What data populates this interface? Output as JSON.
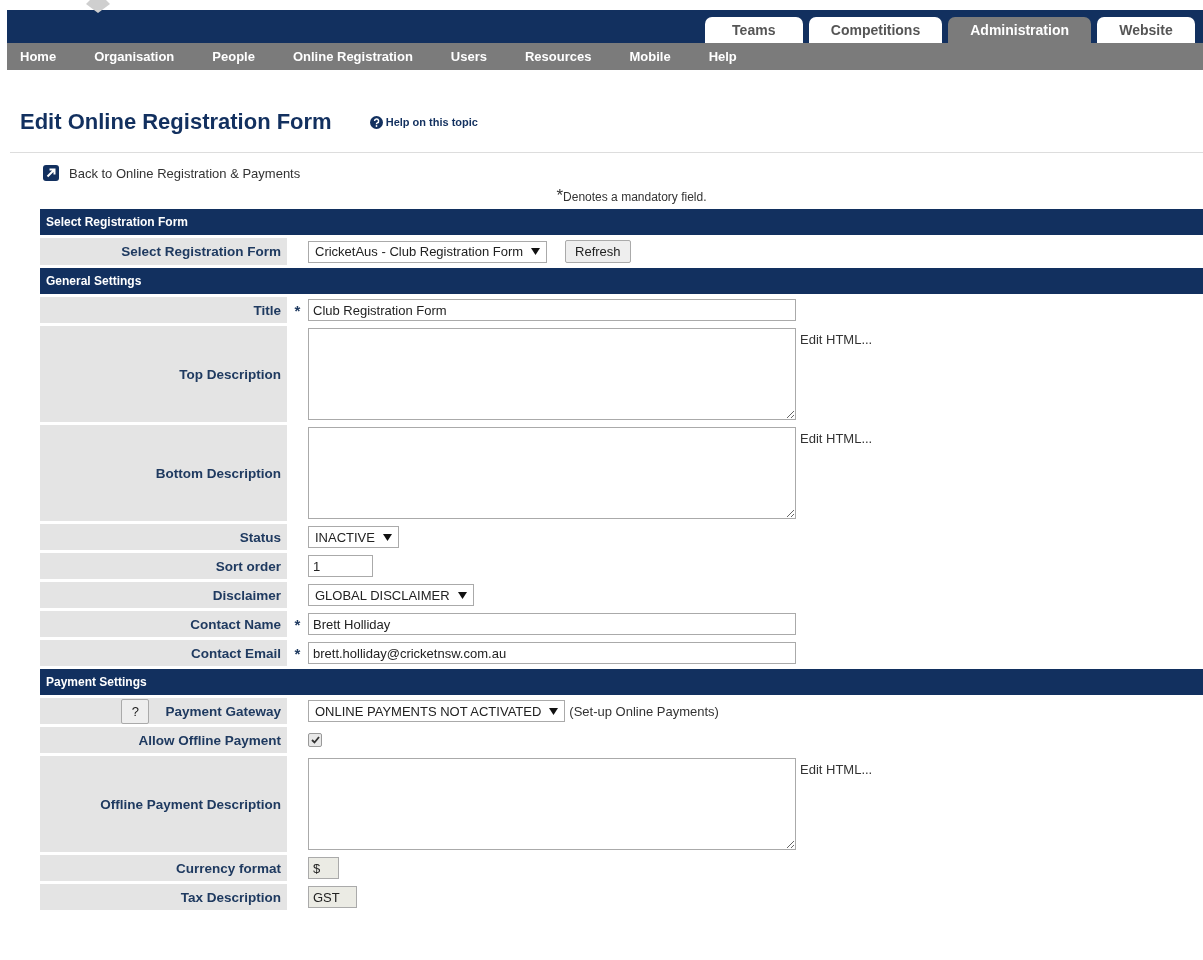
{
  "header_tabs": [
    {
      "label": "Teams",
      "selected": false
    },
    {
      "label": "Competitions",
      "selected": false
    },
    {
      "label": "Administration",
      "selected": true
    },
    {
      "label": "Website",
      "selected": false
    }
  ],
  "nav": [
    "Home",
    "Organisation",
    "People",
    "Online Registration",
    "Users",
    "Resources",
    "Mobile",
    "Help"
  ],
  "page_title": "Edit Online Registration Form",
  "help_link": "Help on this topic",
  "back_link": "Back to Online Registration & Payments",
  "mandatory_note": {
    "mark": "*",
    "text": "Denotes a mandatory field."
  },
  "sections": [
    {
      "title": "Select Registration Form",
      "rows": [
        {
          "kind": "select",
          "label": "Select Registration Form",
          "required": false,
          "value": "CricketAus - Club Registration Form",
          "button": "Refresh"
        }
      ]
    },
    {
      "title": "General Settings",
      "rows": [
        {
          "kind": "text",
          "label": "Title",
          "required": true,
          "value": "Club Registration Form"
        },
        {
          "kind": "textarea",
          "label": "Top Description",
          "required": false,
          "side_link": "Edit HTML..."
        },
        {
          "kind": "textarea",
          "label": "Bottom Description",
          "required": false,
          "side_link": "Edit HTML..."
        },
        {
          "kind": "select",
          "label": "Status",
          "required": false,
          "value": "INACTIVE"
        },
        {
          "kind": "short-text",
          "label": "Sort order",
          "required": false,
          "value": "1"
        },
        {
          "kind": "select",
          "label": "Disclaimer",
          "required": false,
          "value": "GLOBAL DISCLAIMER"
        },
        {
          "kind": "text",
          "label": "Contact Name",
          "required": true,
          "value": "Brett Holliday"
        },
        {
          "kind": "text",
          "label": "Contact Email",
          "required": true,
          "value": "brett.holliday@cricketnsw.com.au"
        }
      ]
    },
    {
      "title": "Payment Settings",
      "rows": [
        {
          "kind": "select",
          "label": "Payment Gateway",
          "required": false,
          "help_button": "?",
          "value": "ONLINE PAYMENTS NOT ACTIVATED",
          "suffix": "(Set-up Online Payments)"
        },
        {
          "kind": "checkbox",
          "label": "Allow Offline Payment",
          "required": false,
          "checked": true
        },
        {
          "kind": "textarea",
          "label": "Offline Payment Description",
          "required": false,
          "side_link": "Edit HTML..."
        },
        {
          "kind": "readonly-text",
          "label": "Currency format",
          "required": false,
          "value": "$"
        },
        {
          "kind": "readonly-text",
          "label": "Tax Description",
          "required": false,
          "value": "GST"
        }
      ]
    }
  ]
}
